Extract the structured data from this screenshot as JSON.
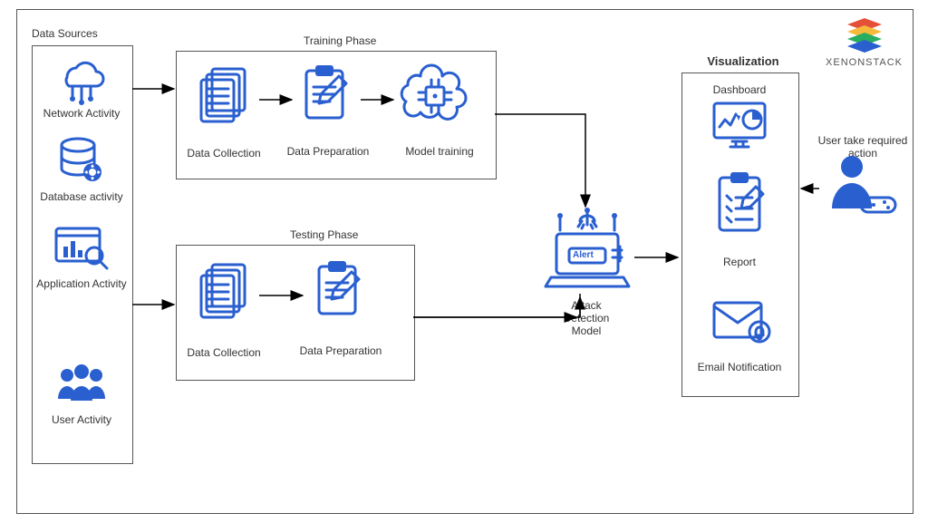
{
  "brand": "XENONSTACK",
  "sections": {
    "sources_title": "Data Sources",
    "training_title": "Training Phase",
    "testing_title": "Testing Phase",
    "visualization_title": "Visualization"
  },
  "sources": {
    "network": "Network Activity",
    "database": "Database activity",
    "application": "Application Activity",
    "user": "User Activity"
  },
  "training": {
    "collection": "Data Collection",
    "preparation": "Data Preparation",
    "model": "Model training"
  },
  "testing": {
    "collection": "Data Collection",
    "preparation": "Data Preparation"
  },
  "center": {
    "attack_line1": "Attack",
    "attack_line2": "Detection",
    "attack_line3": "Model",
    "alert_badge": "Alert"
  },
  "visualization": {
    "dashboard": "Dashboard",
    "report": "Report",
    "email": "Email Notification"
  },
  "user_action": "User take required action",
  "colors": {
    "primary": "#2a5fd0"
  }
}
